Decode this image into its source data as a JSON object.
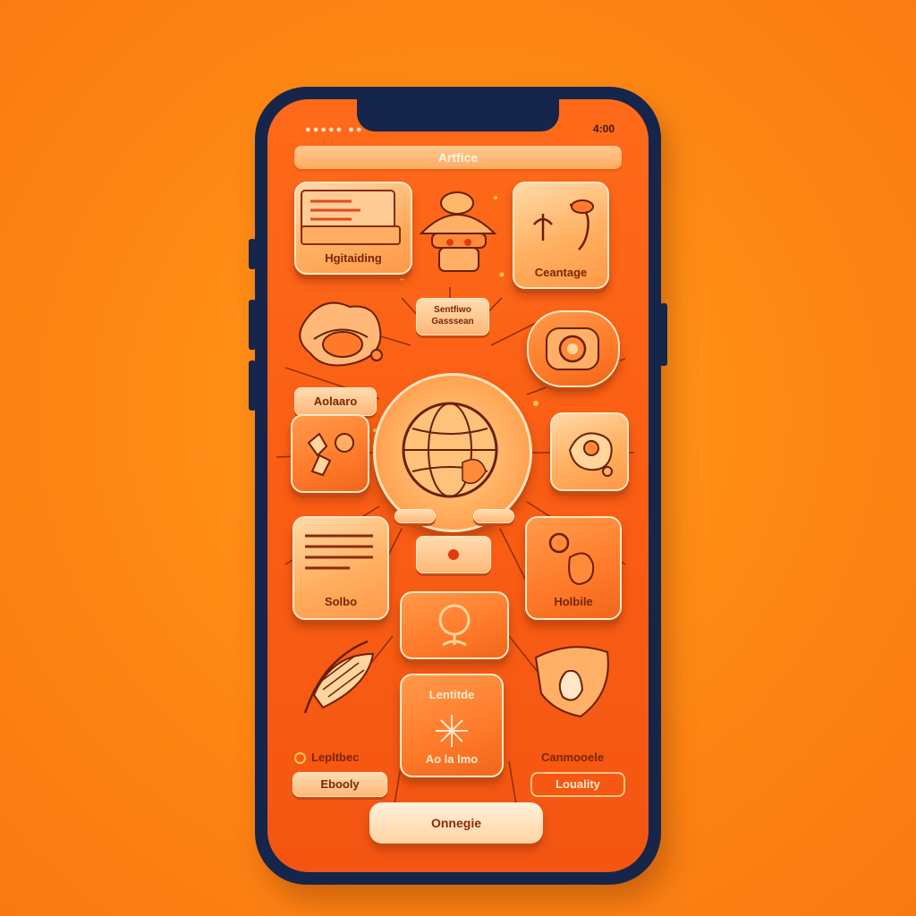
{
  "status": {
    "left": "●●●●● ●●",
    "right": "4:00"
  },
  "header": {
    "title": "Artfice"
  },
  "tiles": {
    "heightening": "Hgitaiding",
    "orange": "Ceantage",
    "badge": "Sentfiwo Gasssean",
    "adaro": "Aolaaro",
    "solbo": "Solbo",
    "holdie": "Holbile",
    "lentlode": "Lentitde",
    "aotabo": "Ao la lmo"
  },
  "bottom": {
    "left_label": "Lepltbec",
    "left_pill": "Ebooly",
    "right_label": "Canmooele",
    "right_pill": "Louality",
    "cta": "Onnegie"
  },
  "colors": {
    "background": "#ff8a14",
    "phone_frame": "#16264a",
    "screen": "#fa5e14",
    "tile": "#ffb060"
  },
  "icons": [
    "globe-icon",
    "document-icon",
    "mushroom-icon",
    "phone-icon",
    "leaf-icon",
    "camera-icon",
    "map-icon",
    "list-icon",
    "gear-icon",
    "bulb-icon",
    "wheat-icon",
    "sparkle-icon",
    "fruit-icon"
  ]
}
